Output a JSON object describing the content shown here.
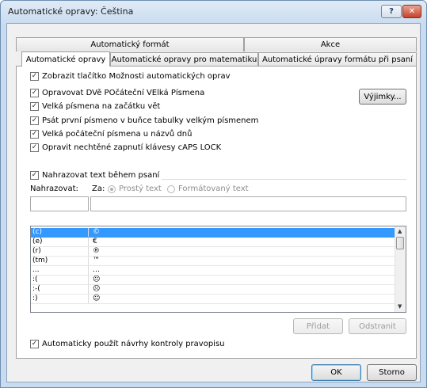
{
  "window": {
    "title": "Automatické opravy: Čeština",
    "help_label": "?",
    "close_label": "✕"
  },
  "tabs": {
    "back": [
      {
        "label": "Automatický formát"
      },
      {
        "label": "Akce"
      }
    ],
    "front": [
      {
        "label": "Automatické opravy"
      },
      {
        "label": "Automatické opravy pro matematiku"
      },
      {
        "label": "Automatické úpravy formátu při psaní"
      }
    ]
  },
  "options": {
    "show_buttons": "Zobrazit tlačítko Možnosti automatických oprav",
    "two_capitals": "Opravovat DVě POčáteční VElká Písmena",
    "sentence_capital": "Velká písmena na začátku vět",
    "table_cell": "Psát první písmeno v buňce tabulky velkým písmenem",
    "day_names": "Velká počáteční písmena u názvů dnů",
    "caps_lock": "Opravit nechtěné zapnutí klávesy cAPS LOCK",
    "exceptions_label": "Výjimky..."
  },
  "replace": {
    "checkbox_label": "Nahrazovat text během psaní",
    "replace_label": "Nahrazovat:",
    "with_label": "Za:",
    "plain_text": "Prostý text",
    "formatted_text": "Formátovaný text",
    "replace_value": "",
    "with_value": ""
  },
  "table": {
    "rows": [
      {
        "from": "(c)",
        "to": "©",
        "selected": true
      },
      {
        "from": "(e)",
        "to": "€"
      },
      {
        "from": "(r)",
        "to": "®"
      },
      {
        "from": "(tm)",
        "to": "™"
      },
      {
        "from": "...",
        "to": "…"
      },
      {
        "from": ":(",
        "to": "☹"
      },
      {
        "from": ":-(",
        "to": "☹"
      },
      {
        "from": ":)",
        "to": "☺"
      }
    ]
  },
  "actions": {
    "add_label": "Přidat",
    "delete_label": "Odstranit"
  },
  "spelling": {
    "label": "Automaticky použít návrhy kontroly pravopisu"
  },
  "footer": {
    "ok_label": "OK",
    "cancel_label": "Storno"
  }
}
